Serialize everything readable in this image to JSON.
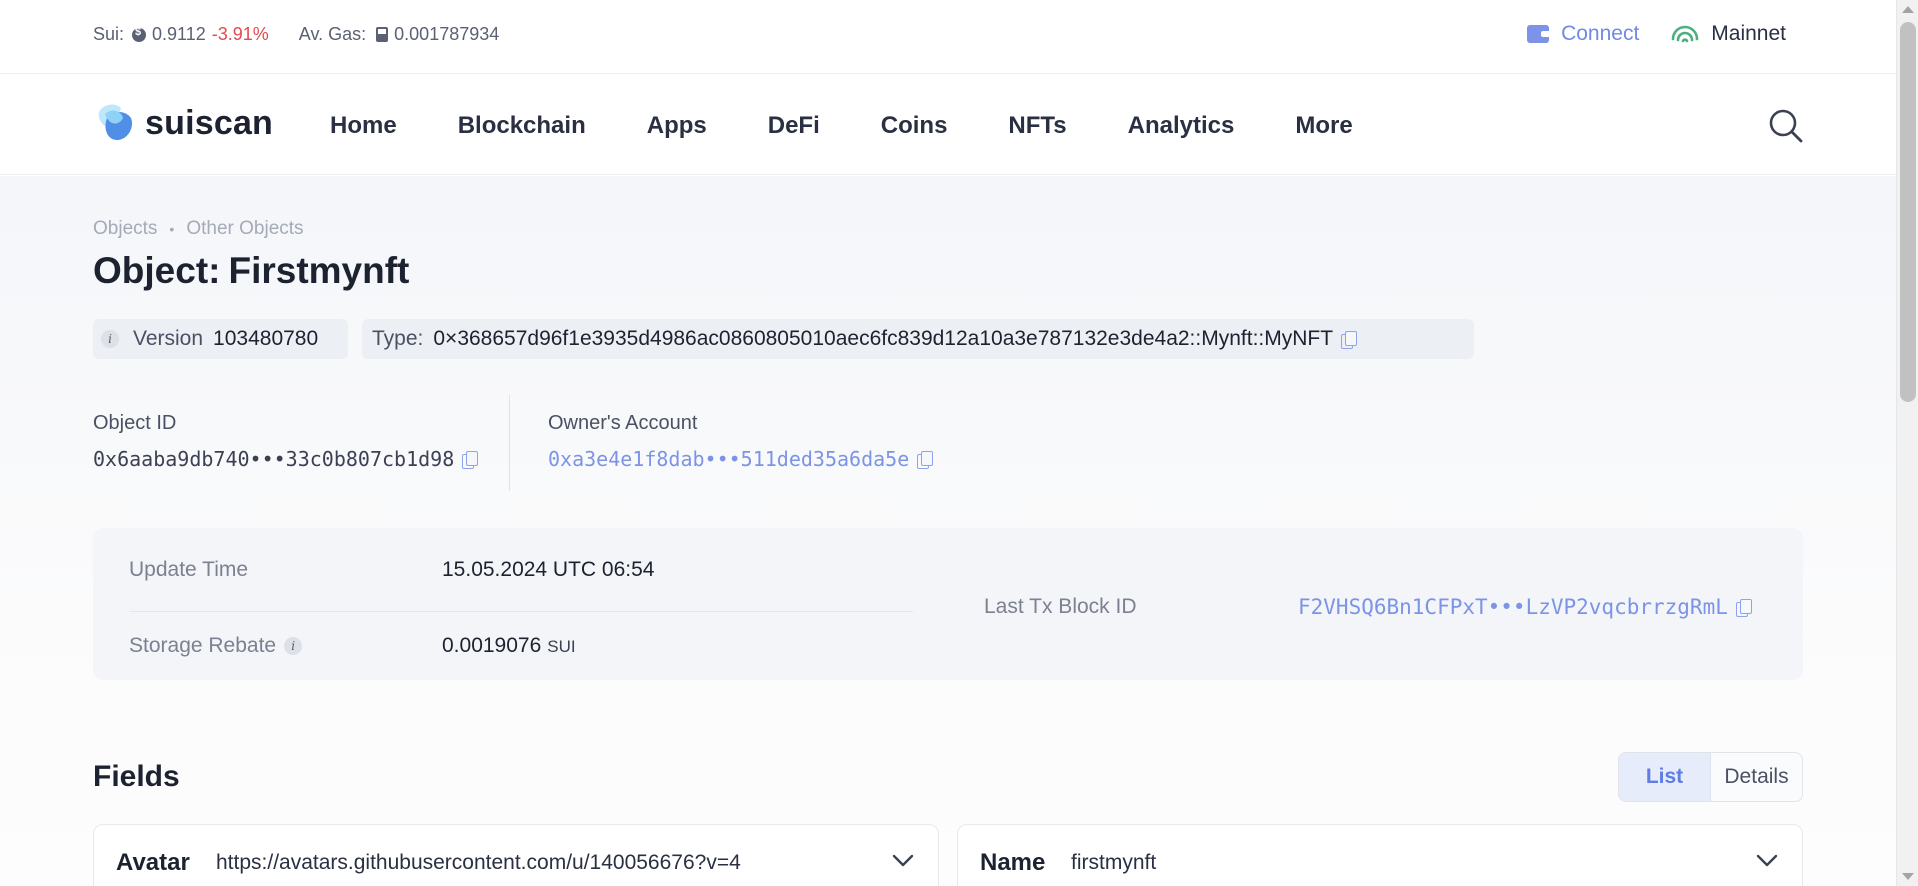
{
  "ticker": {
    "sui_label": "Sui:",
    "sui_price": "0.9112",
    "sui_change": "-3.91%",
    "gas_label": "Av. Gas:",
    "gas_value": "0.001787934",
    "connect_label": "Connect",
    "network_label": "Mainnet"
  },
  "nav": {
    "logo_text": "suiscan",
    "menu": [
      "Home",
      "Blockchain",
      "Apps",
      "DeFi",
      "Coins",
      "NFTs",
      "Analytics",
      "More"
    ]
  },
  "breadcrumb": [
    "Objects",
    "Other Objects"
  ],
  "title": {
    "prefix": "Object:",
    "name": "Firstmynft"
  },
  "version": {
    "label": "Version",
    "value": "103480780"
  },
  "type": {
    "label": "Type:",
    "value": "0×368657d96f1e3935d4986ac0860805010aec6fc839d12a10a3e787132e3de4a2::Mynft::MyNFT"
  },
  "object_id": {
    "label": "Object ID",
    "value": "0x6aaba9db740•••33c0b807cb1d98"
  },
  "owner": {
    "label": "Owner's Account",
    "value": "0xa3e4e1f8dab•••511ded35a6da5e"
  },
  "details": {
    "update_time_label": "Update Time",
    "update_time_value": "15.05.2024 UTC 06:54",
    "storage_rebate_label": "Storage Rebate",
    "storage_rebate_value": "0.0019076",
    "storage_rebate_unit": "SUI",
    "last_tx_label": "Last Tx Block ID",
    "last_tx_value": "F2VHSQ6Bn1CFPxT•••LzVP2vqcbrrzgRmL"
  },
  "fields": {
    "title": "Fields",
    "view_list": "List",
    "view_details": "Details",
    "items": [
      {
        "key": "Avatar",
        "value": "https://avatars.githubusercontent.com/u/140056676?v=4"
      },
      {
        "key": "Name",
        "value": "firstmynft"
      }
    ]
  },
  "colors": {
    "accent": "#6f8be6",
    "negative": "#e5484d",
    "link": "#7b94e6"
  }
}
